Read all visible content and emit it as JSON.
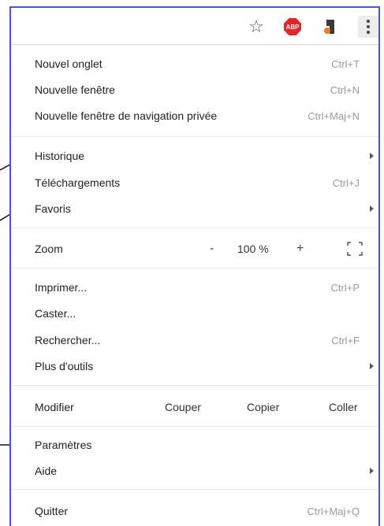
{
  "toolbar": {
    "star_icon": "star-icon",
    "abp_label": "ABP",
    "extension_icon": "extension-icon",
    "menu_icon": "kebab-menu-icon"
  },
  "menu": {
    "new_tab": {
      "label": "Nouvel onglet",
      "shortcut": "Ctrl+T"
    },
    "new_window": {
      "label": "Nouvelle fenêtre",
      "shortcut": "Ctrl+N"
    },
    "incognito": {
      "label": "Nouvelle fenêtre de navigation privée",
      "shortcut": "Ctrl+Maj+N"
    },
    "history": {
      "label": "Historique"
    },
    "downloads": {
      "label": "Téléchargements",
      "shortcut": "Ctrl+J"
    },
    "bookmarks": {
      "label": "Favoris"
    },
    "zoom": {
      "label": "Zoom",
      "minus": "-",
      "value": "100 %",
      "plus": "+"
    },
    "print": {
      "label": "Imprimer...",
      "shortcut": "Ctrl+P"
    },
    "cast": {
      "label": "Caster..."
    },
    "find": {
      "label": "Rechercher...",
      "shortcut": "Ctrl+F"
    },
    "more_tools": {
      "label": "Plus d'outils"
    },
    "edit": {
      "label": "Modifier",
      "cut": "Couper",
      "copy": "Copier",
      "paste": "Coller"
    },
    "settings": {
      "label": "Paramètres"
    },
    "help": {
      "label": "Aide"
    },
    "quit": {
      "label": "Quitter",
      "shortcut": "Ctrl+Maj+Q"
    }
  },
  "colors": {
    "frame_border": "#4a52e0",
    "abp_red": "#e32727",
    "ext_orange": "#f07a20"
  }
}
